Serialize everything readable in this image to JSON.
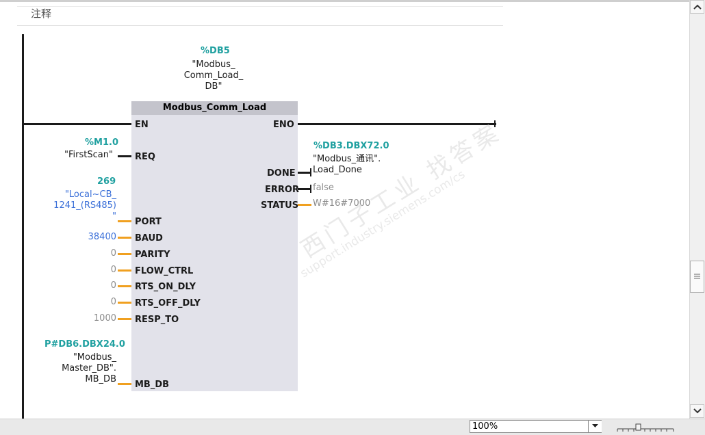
{
  "comment": {
    "label": "注释"
  },
  "instance_db": {
    "address": "%DB5",
    "name_lines": [
      "\"Modbus_",
      "Comm_Load_",
      "DB\""
    ]
  },
  "block": {
    "title": "Modbus_Comm_Load",
    "en": "EN",
    "eno": "ENO"
  },
  "inputs": {
    "req": {
      "tag": "%M1.0",
      "symbol": "\"FirstScan\"",
      "pin": "REQ"
    },
    "port": {
      "value": "269",
      "symbol_lines": [
        "\"Local~CB_",
        "1241_(RS485)",
        "\""
      ],
      "pin": "PORT"
    },
    "baud": {
      "value": "38400",
      "pin": "BAUD"
    },
    "parity": {
      "value": "0",
      "pin": "PARITY"
    },
    "flow_ctrl": {
      "value": "0",
      "pin": "FLOW_CTRL"
    },
    "rts_on_dly": {
      "value": "0",
      "pin": "RTS_ON_DLY"
    },
    "rts_off_dly": {
      "value": "0",
      "pin": "RTS_OFF_DLY"
    },
    "resp_to": {
      "value": "1000",
      "pin": "RESP_TO"
    },
    "mb_db": {
      "tag": "P#DB6.DBX24.0",
      "symbol_lines": [
        "\"Modbus_",
        "Master_DB\".",
        "MB_DB"
      ],
      "pin": "MB_DB"
    }
  },
  "outputs": {
    "done": {
      "tag": "%DB3.DBX72.0",
      "symbol_lines": [
        "\"Modbus_通讯\".",
        "Load_Done"
      ],
      "pin": "DONE"
    },
    "error": {
      "value": "false",
      "pin": "ERROR"
    },
    "status": {
      "value": "W#16#7000",
      "pin": "STATUS"
    }
  },
  "watermark": {
    "brand": "西门子工业 找答案",
    "url": "support.industry.siemens.com/cs"
  },
  "statusbar": {
    "zoom": "100%"
  },
  "colors": {
    "tag": "#1fa0a0",
    "constant": "#3a6fd8",
    "wire_param": "#f0a020",
    "block_body": "#e2e2ea",
    "block_header": "#c4c4cc"
  },
  "icons": {
    "scroll_up": "arrow-up-icon",
    "scroll_down": "arrow-down-icon",
    "scroll_thumb": "grip-icon",
    "zoom_drop": "chevron-down-icon"
  }
}
